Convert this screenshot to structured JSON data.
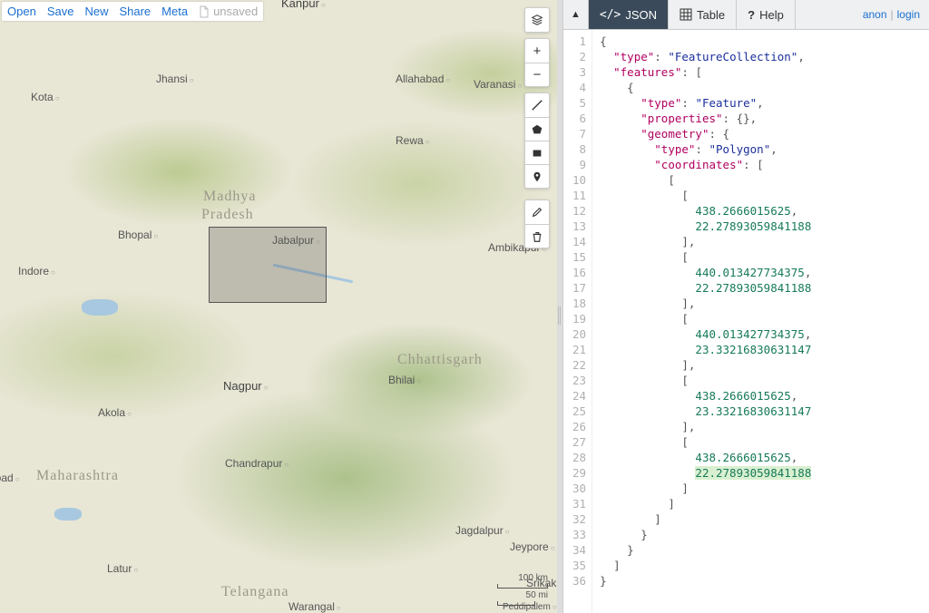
{
  "file_bar": {
    "open": "Open",
    "save": "Save",
    "new": "New",
    "share": "Share",
    "meta": "Meta",
    "unsaved": "unsaved"
  },
  "map": {
    "states": {
      "mp1": "Madhya",
      "mp2": "Pradesh",
      "maharashtra": "Maharashtra",
      "chhattisgarh": "Chhattisgarh",
      "telangana": "Telangana"
    },
    "cities": {
      "kanpur": "Kanpur",
      "jhansi": "Jhansi",
      "allahabad": "Allahabad",
      "varanasi": "Varanasi",
      "kota": "Kota",
      "rewa": "Rewa",
      "bhopal": "Bhopal",
      "jabalpur": "Jabalpur",
      "ambikapur": "Ambikapur",
      "indore": "Indore",
      "nagpur": "Nagpur",
      "bhilai": "Bhilai",
      "akola": "Akola",
      "chandrapur": "Chandrapur",
      "jagdalpur": "Jagdalpur",
      "jeypore": "Jeypore",
      "latur": "Latur",
      "warangal": "Warangal",
      "srikak": "Srikak",
      "abad": "abad",
      "peddipalem": "Peddipalem"
    },
    "scale_km": "100 km",
    "scale_mi": "50 mi"
  },
  "tabs": {
    "json": "JSON",
    "table": "Table",
    "help": "Help"
  },
  "user": {
    "anon": "anon",
    "login": "login"
  },
  "geojson": {
    "type": "FeatureCollection",
    "features": [
      {
        "type": "Feature",
        "properties": {},
        "geometry": {
          "type": "Polygon",
          "coordinates": [
            [
              [
                438.2666015625,
                22.27893059841188
              ],
              [
                440.013427734375,
                22.27893059841188
              ],
              [
                440.013427734375,
                23.33216830631147
              ],
              [
                438.2666015625,
                23.33216830631147
              ],
              [
                438.2666015625,
                22.27893059841188
              ]
            ]
          ]
        }
      }
    ]
  },
  "code_lines": [
    [
      [
        "p",
        "{"
      ]
    ],
    [
      [
        "p",
        "  "
      ],
      [
        "k",
        "\"type\""
      ],
      [
        "p",
        ": "
      ],
      [
        "s",
        "\"FeatureCollection\""
      ],
      [
        "p",
        ","
      ]
    ],
    [
      [
        "p",
        "  "
      ],
      [
        "k",
        "\"features\""
      ],
      [
        "p",
        ": ["
      ]
    ],
    [
      [
        "p",
        "    {"
      ]
    ],
    [
      [
        "p",
        "      "
      ],
      [
        "k",
        "\"type\""
      ],
      [
        "p",
        ": "
      ],
      [
        "s",
        "\"Feature\""
      ],
      [
        "p",
        ","
      ]
    ],
    [
      [
        "p",
        "      "
      ],
      [
        "k",
        "\"properties\""
      ],
      [
        "p",
        ": {},"
      ]
    ],
    [
      [
        "p",
        "      "
      ],
      [
        "k",
        "\"geometry\""
      ],
      [
        "p",
        ": {"
      ]
    ],
    [
      [
        "p",
        "        "
      ],
      [
        "k",
        "\"type\""
      ],
      [
        "p",
        ": "
      ],
      [
        "s",
        "\"Polygon\""
      ],
      [
        "p",
        ","
      ]
    ],
    [
      [
        "p",
        "        "
      ],
      [
        "k",
        "\"coordinates\""
      ],
      [
        "p",
        ": ["
      ]
    ],
    [
      [
        "p",
        "          ["
      ]
    ],
    [
      [
        "p",
        "            ["
      ]
    ],
    [
      [
        "p",
        "              "
      ],
      [
        "n",
        "438.2666015625"
      ],
      [
        "p",
        ","
      ]
    ],
    [
      [
        "p",
        "              "
      ],
      [
        "n",
        "22.27893059841188"
      ]
    ],
    [
      [
        "p",
        "            ],"
      ]
    ],
    [
      [
        "p",
        "            ["
      ]
    ],
    [
      [
        "p",
        "              "
      ],
      [
        "n",
        "440.013427734375"
      ],
      [
        "p",
        ","
      ]
    ],
    [
      [
        "p",
        "              "
      ],
      [
        "n",
        "22.27893059841188"
      ]
    ],
    [
      [
        "p",
        "            ],"
      ]
    ],
    [
      [
        "p",
        "            ["
      ]
    ],
    [
      [
        "p",
        "              "
      ],
      [
        "n",
        "440.013427734375"
      ],
      [
        "p",
        ","
      ]
    ],
    [
      [
        "p",
        "              "
      ],
      [
        "n",
        "23.33216830631147"
      ]
    ],
    [
      [
        "p",
        "            ],"
      ]
    ],
    [
      [
        "p",
        "            ["
      ]
    ],
    [
      [
        "p",
        "              "
      ],
      [
        "n",
        "438.2666015625"
      ],
      [
        "p",
        ","
      ]
    ],
    [
      [
        "p",
        "              "
      ],
      [
        "n",
        "23.33216830631147"
      ]
    ],
    [
      [
        "p",
        "            ],"
      ]
    ],
    [
      [
        "p",
        "            ["
      ]
    ],
    [
      [
        "p",
        "              "
      ],
      [
        "n",
        "438.2666015625"
      ],
      [
        "p",
        ","
      ]
    ],
    [
      [
        "p",
        "              "
      ],
      [
        "n hl",
        "22.27893059841188"
      ]
    ],
    [
      [
        "p",
        "            ]"
      ]
    ],
    [
      [
        "p",
        "          ]"
      ]
    ],
    [
      [
        "p",
        "        ]"
      ]
    ],
    [
      [
        "p",
        "      }"
      ]
    ],
    [
      [
        "p",
        "    }"
      ]
    ],
    [
      [
        "p",
        "  ]"
      ]
    ],
    [
      [
        "p",
        "}"
      ]
    ]
  ]
}
